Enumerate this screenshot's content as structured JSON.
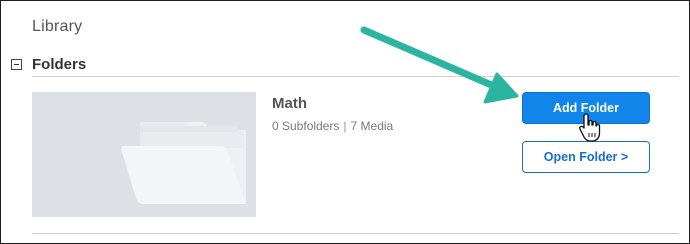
{
  "library": {
    "title": "Library"
  },
  "folders_section": {
    "title": "Folders",
    "toggle_icon": "minus-box-icon",
    "folder": {
      "name": "Math",
      "subfolders": "0 Subfolders",
      "media": "7 Media",
      "separator": "|",
      "thumbnail_icon": "folder-icon"
    },
    "actions": {
      "add_label": "Add Folder",
      "open_label": "Open Folder >"
    }
  },
  "annotation": {
    "arrow_color": "#2bb5a0",
    "cursor_icon": "hand-pointer-icon"
  },
  "colors": {
    "primary": "#1185ea",
    "outline": "#1670c8",
    "thumbnail_bg": "#dde1e6"
  }
}
